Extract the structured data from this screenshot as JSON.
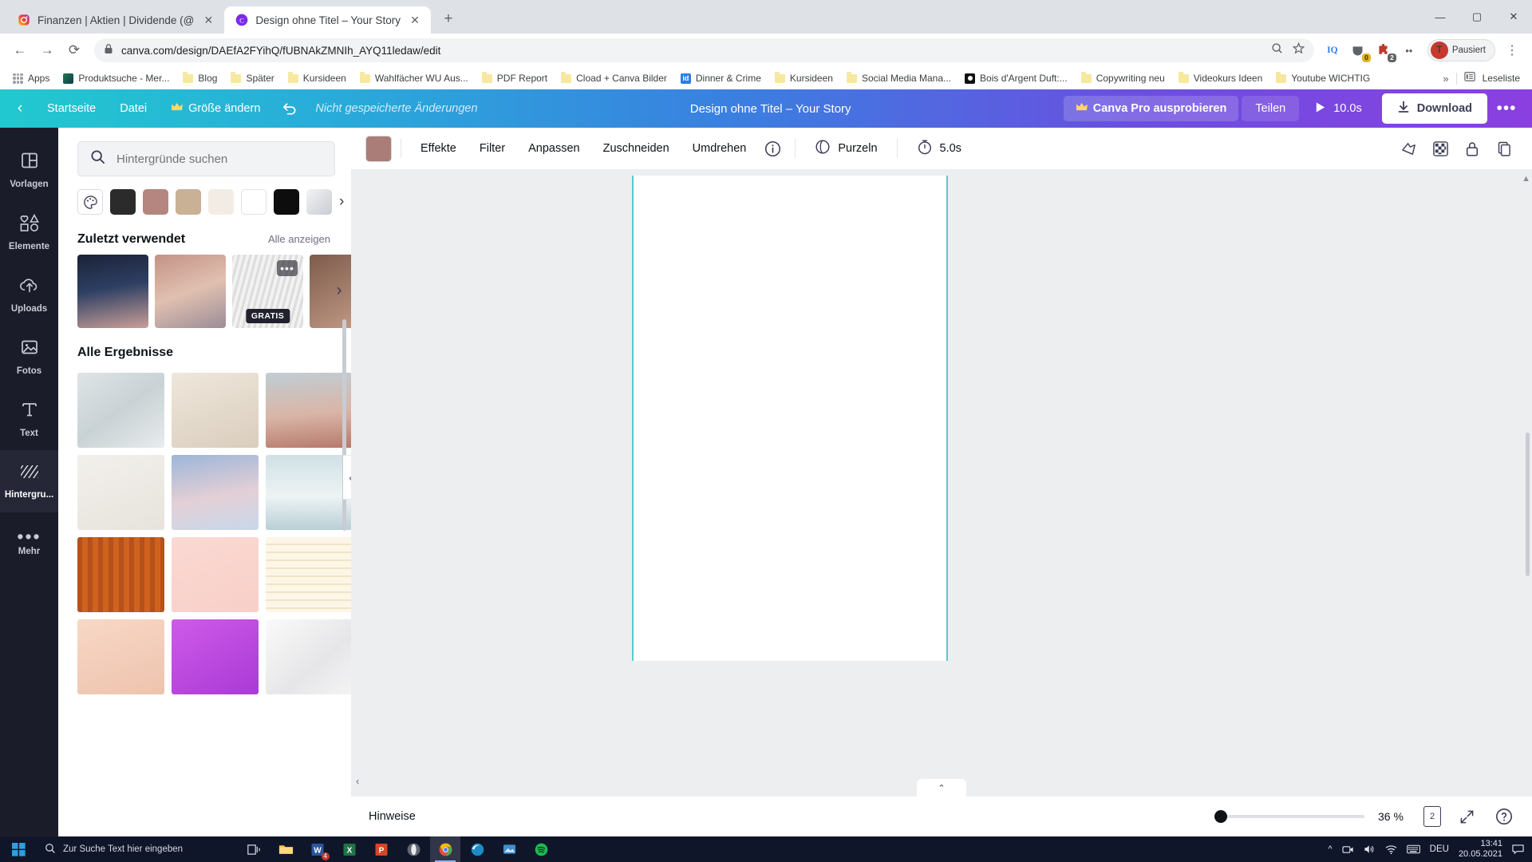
{
  "browser": {
    "tabs": [
      {
        "title": "Finanzen | Aktien | Dividende (@",
        "favicon": "instagram-icon",
        "active": false
      },
      {
        "title": "Design ohne Titel – Your Story",
        "favicon": "canva-icon",
        "active": true
      }
    ],
    "newtab_label": "+",
    "window_controls": {
      "minimize": "—",
      "maximize": "▢",
      "close": "✕"
    },
    "nav": {
      "back": "←",
      "forward": "→",
      "reload": "⟳",
      "lock": "lock-icon"
    },
    "url": "canva.com/design/DAEfA2FYihQ/fUBNAkZMNIh_AYQ11ledaw/edit",
    "omni_icons": [
      "zoom-search-icon",
      "star-icon"
    ],
    "extensions": [
      {
        "name": "iq-extension",
        "label": "IQ",
        "badge": "",
        "badge_color": "#2b7de9"
      },
      {
        "name": "pocket-extension",
        "label": "",
        "badge": "0",
        "badge_color": "#e0b42a"
      },
      {
        "name": "puzzle-extension",
        "label": "",
        "badge": "2",
        "badge_color": "#5f6368"
      },
      {
        "name": "overflow-extension",
        "label": "••",
        "badge": "",
        "badge_color": ""
      }
    ],
    "profile": {
      "initial": "T",
      "label": "Pausiert"
    },
    "menu_icon": "⋮",
    "bookmarks": [
      {
        "label": "Apps",
        "icon": "apps-grid-icon"
      },
      {
        "label": "Produktsuche - Mer...",
        "icon": "site-icon-green"
      },
      {
        "label": "Blog",
        "icon": "folder-icon"
      },
      {
        "label": "Später",
        "icon": "folder-icon"
      },
      {
        "label": "Kursideen",
        "icon": "folder-icon"
      },
      {
        "label": "Wahlfächer WU Aus...",
        "icon": "folder-icon"
      },
      {
        "label": "PDF Report",
        "icon": "folder-icon"
      },
      {
        "label": "Cload + Canva Bilder",
        "icon": "folder-icon"
      },
      {
        "label": "Dinner & Crime",
        "icon": "indesign-icon"
      },
      {
        "label": "Kursideen",
        "icon": "folder-icon"
      },
      {
        "label": "Social Media Mana...",
        "icon": "folder-icon"
      },
      {
        "label": "Bois d'Argent Duft:...",
        "icon": "site-icon-dark"
      },
      {
        "label": "Copywriting neu",
        "icon": "folder-icon"
      },
      {
        "label": "Videokurs Ideen",
        "icon": "folder-icon"
      },
      {
        "label": "Youtube WICHTIG",
        "icon": "folder-icon"
      }
    ],
    "bookmarks_overflow": "»",
    "reading_list": "Leseliste"
  },
  "canva": {
    "topbar": {
      "back_icon": "chevron-left-icon",
      "home": "Startseite",
      "file": "Datei",
      "resize": "Größe ändern",
      "resize_icon": "crown-icon",
      "undo_icon": "undo-arrow-icon",
      "unsaved": "Nicht gespeicherte Änderungen",
      "doc_title": "Design ohne Titel – Your Story",
      "pro_button": "Canva Pro ausprobieren",
      "pro_icon": "crown-icon",
      "share": "Teilen",
      "play_icon": "play-icon",
      "play_duration": "10.0s",
      "download": "Download",
      "download_icon": "download-icon",
      "more": "•••"
    },
    "rail": [
      {
        "label": "Vorlagen",
        "icon": "templates-icon",
        "active": false
      },
      {
        "label": "Elemente",
        "icon": "elements-icon",
        "active": false
      },
      {
        "label": "Uploads",
        "icon": "upload-cloud-icon",
        "active": false
      },
      {
        "label": "Fotos",
        "icon": "photo-icon",
        "active": false
      },
      {
        "label": "Text",
        "icon": "text-icon",
        "active": false
      },
      {
        "label": "Hintergru...",
        "icon": "background-icon",
        "active": true
      },
      {
        "label": "Mehr",
        "icon": "more-dots-icon",
        "active": false
      }
    ],
    "panel": {
      "search_placeholder": "Hintergründe suchen",
      "search_value": "",
      "search_icon": "search-icon",
      "swatches": [
        {
          "name": "palette",
          "color": "#ffffff"
        },
        {
          "name": "swatch-1",
          "color": "#2b2b2b"
        },
        {
          "name": "swatch-2",
          "color": "#b5867f"
        },
        {
          "name": "swatch-3",
          "color": "#c9b195"
        },
        {
          "name": "swatch-4",
          "color": "#f3ece5"
        },
        {
          "name": "swatch-5",
          "color": "#ffffff"
        },
        {
          "name": "swatch-6",
          "color": "#0d0d0d"
        },
        {
          "name": "swatch-7",
          "color": "#d7d9dd"
        }
      ],
      "swatch_next": "›",
      "recent_title": "Zuletzt verwendet",
      "recent_link": "Alle anzeigen",
      "recent_items": [
        {
          "name": "recent-1",
          "gradient": "linear-gradient(170deg,#1b2238 0%,#2e3f63 45%,#c99f97 100%)",
          "badge": "",
          "dots": false
        },
        {
          "name": "recent-2",
          "gradient": "linear-gradient(160deg,#c49287 0%,#e0c0b0 50%,#9c8d98 100%)",
          "badge": "",
          "dots": false
        },
        {
          "name": "recent-3",
          "gradient": "repeating-linear-gradient(105deg,#dcdcdc 0 3px,#f2f2f2 3px 7px)",
          "badge": "GRATIS",
          "dots": true
        },
        {
          "name": "recent-4",
          "gradient": "linear-gradient(150deg,#7d5b4c,#c9a18c)",
          "badge": "",
          "dots": false
        }
      ],
      "recent_next": "›",
      "results_title": "Alle Ergebnisse",
      "results": [
        {
          "name": "bg-frost",
          "gradient": "linear-gradient(145deg,#dfe4e6,#c9d2d5 50%,#e8eced)"
        },
        {
          "name": "bg-beige",
          "gradient": "linear-gradient(160deg,#efe7db,#d9cdbd)"
        },
        {
          "name": "bg-sunset",
          "gradient": "linear-gradient(175deg,#c0cdd4 0%,#d9b5a6 55%,#b6796b 100%)"
        },
        {
          "name": "bg-berries",
          "gradient": "linear-gradient(160deg,#f2f0ec,#e7e3dc)"
        },
        {
          "name": "bg-clouds",
          "gradient": "linear-gradient(170deg,#9db6d8 0%,#e3cfd6 55%,#c8d8ea 100%)"
        },
        {
          "name": "bg-ice",
          "gradient": "linear-gradient(180deg,#cfe0e6 0%,#eef3f4 55%,#b9cfd6 100%)"
        },
        {
          "name": "bg-wood",
          "gradient": "repeating-linear-gradient(90deg,#b5511a 0 6px,#d0621f 6px 13px)"
        },
        {
          "name": "bg-pink",
          "gradient": "linear-gradient(160deg,#fbd9d3,#f7cfc8)"
        },
        {
          "name": "bg-lines",
          "gradient": "repeating-linear-gradient(180deg,#fdf6e6 0 8px,#f0e3c8 8px 10px)"
        },
        {
          "name": "bg-peach",
          "gradient": "linear-gradient(160deg,#f7d8c6,#eec3ad)"
        },
        {
          "name": "bg-purple",
          "gradient": "linear-gradient(150deg,#cf5ae8,#a93ad6)"
        },
        {
          "name": "bg-marble",
          "gradient": "linear-gradient(140deg,#fafafa,#e6e6e8 60%,#f4f4f5)"
        }
      ],
      "collapse_icon": "‹"
    },
    "subtoolbar": {
      "color_swatch": "#ab7d78",
      "items": [
        "Effekte",
        "Filter",
        "Anpassen",
        "Zuschneiden",
        "Umdrehen"
      ],
      "info_icon": "info-icon",
      "animate_icon": "animate-icon",
      "animate": "Purzeln",
      "timer_icon": "timer-icon",
      "duration": "5.0s",
      "right_icons": [
        "position-icon",
        "transparency-icon",
        "lock-icon",
        "duplicate-icon"
      ]
    },
    "statusbar": {
      "notes": "Hinweise",
      "zoom": "36 %",
      "zoom_value": 5,
      "page_count": "2",
      "expand_icon": "expand-icon",
      "help_icon": "help-icon",
      "collapse_icon": "⌃"
    }
  },
  "taskbar": {
    "start_icon": "windows-icon",
    "search_placeholder": "Zur Suche Text hier eingeben",
    "search_icon": "search-icon",
    "items": [
      {
        "name": "task-view-icon",
        "badge": ""
      },
      {
        "name": "file-explorer-icon",
        "badge": ""
      },
      {
        "name": "word-icon",
        "badge": "4"
      },
      {
        "name": "excel-icon",
        "badge": ""
      },
      {
        "name": "powerpoint-icon",
        "badge": ""
      },
      {
        "name": "opera-icon",
        "badge": ""
      },
      {
        "name": "chrome-icon",
        "badge": "",
        "active": true
      },
      {
        "name": "edge-icon",
        "badge": ""
      },
      {
        "name": "photos-icon",
        "badge": ""
      },
      {
        "name": "spotify-icon",
        "badge": ""
      }
    ],
    "tray": {
      "overflow": "^",
      "icons": [
        "camera-icon",
        "volume-icon",
        "wifi-icon",
        "keyboard-icon"
      ],
      "language": "DEU",
      "time": "13:41",
      "date": "20.05.2021",
      "notification_icon": "notification-icon"
    }
  }
}
